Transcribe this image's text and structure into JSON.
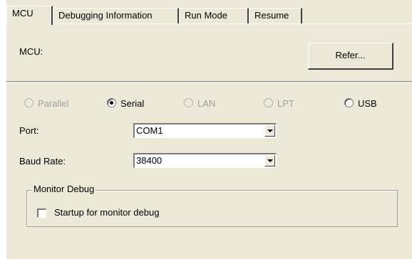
{
  "tabs": [
    {
      "label": "MCU",
      "active": true
    },
    {
      "label": "Debugging Information",
      "active": false
    },
    {
      "label": "Run Mode",
      "active": false
    },
    {
      "label": "Resume",
      "active": false
    }
  ],
  "mcu": {
    "label": "MCU:",
    "refer_button": "Refer..."
  },
  "connection": {
    "options": [
      {
        "label": "Parallel",
        "selected": false,
        "enabled": false
      },
      {
        "label": "Serial",
        "selected": true,
        "enabled": true
      },
      {
        "label": "LAN",
        "selected": false,
        "enabled": false
      },
      {
        "label": "LPT",
        "selected": false,
        "enabled": false
      },
      {
        "label": "USB",
        "selected": false,
        "enabled": true
      }
    ]
  },
  "port": {
    "label": "Port:",
    "value": "COM1"
  },
  "baud": {
    "label": "Baud Rate:",
    "value": "38400"
  },
  "monitor": {
    "group_title": "Monitor Debug",
    "checkbox_label": "Startup for monitor debug",
    "checked": false
  }
}
